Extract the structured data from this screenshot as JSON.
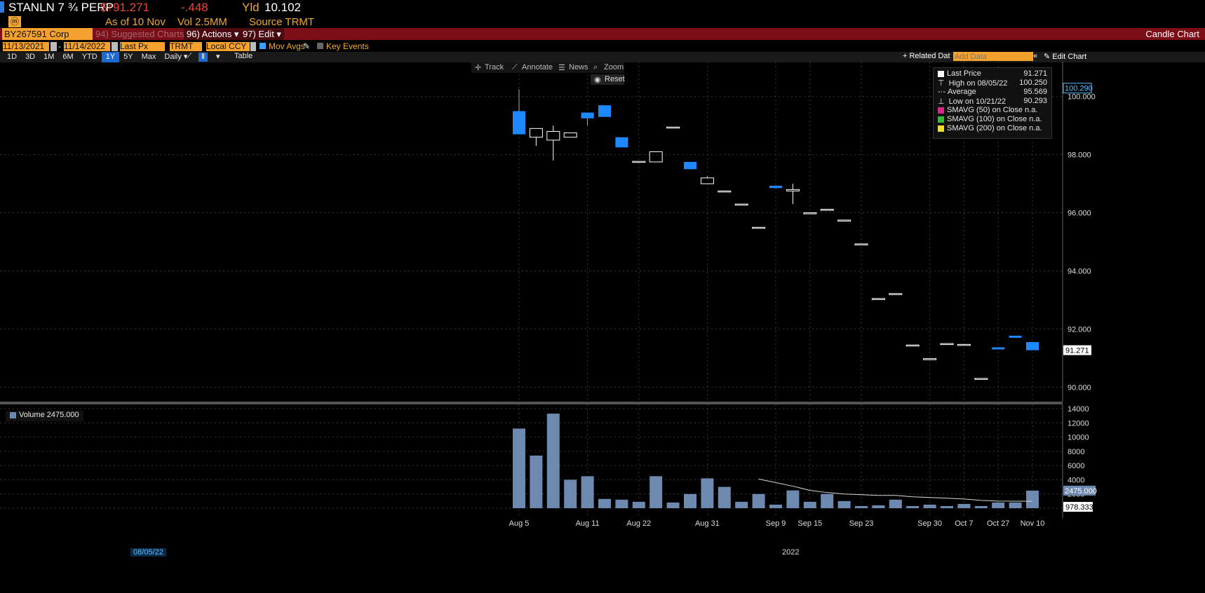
{
  "header": {
    "ticker": "STANLN 7 ¾ PERP",
    "price": "$↑91.271",
    "change": "-.448",
    "yld_label": "Yld",
    "yld_value": "10.102",
    "asof": "As of 10 Nov",
    "vol": "Vol 2.5MM",
    "source": "Source TRMT",
    "security": "BY267591 Corp",
    "suggested": "94) Suggested Charts",
    "actions": "96) Actions ▾",
    "edit": "97) Edit ▾",
    "chart_type": "Candle Chart"
  },
  "options": {
    "start_date": "11/13/2021",
    "end_date": "11/14/2022",
    "field": "Last Px",
    "source": "TRMT",
    "currency": "Local CCY",
    "mov_avgs": "Mov Avgs",
    "key_events": "Key Events",
    "related_data": "+ Related Dat",
    "add_data_placeholder": "Add Data",
    "edit_chart": "✎ Edit Chart"
  },
  "ranges": [
    "1D",
    "3D",
    "1M",
    "6M",
    "YTD",
    "1Y",
    "5Y",
    "Max"
  ],
  "range_selected": "1Y",
  "period": "Daily ▾",
  "table_label": "Table",
  "tools": {
    "track": "Track",
    "annotate": "Annotate",
    "news": "News",
    "zoom": "Zoom",
    "reset": "Reset"
  },
  "legend": {
    "last_price_label": "Last Price",
    "last_price_value": "91.271",
    "high_label": "High on 08/05/22",
    "high_value": "100.250",
    "avg_label": "Average",
    "avg_value": "95.569",
    "low_label": "Low on 10/21/22",
    "low_value": "90.293",
    "sma50": "SMAVG (50)  on Close  n.a.",
    "sma100": "SMAVG (100)  on Close n.a.",
    "sma200": "SMAVG (200)  on Close n.a.",
    "colors": {
      "sma50": "#e0208c",
      "sma100": "#2fc02f",
      "sma200": "#f0e020"
    }
  },
  "volume_legend": "Volume 2475.000",
  "selected_date": "08/05/22",
  "year_label": "2022",
  "chart_data": {
    "type": "bar",
    "candles": [
      {
        "o": 98.7,
        "h": 100.25,
        "l": 98.7,
        "c": 99.5,
        "up": false
      },
      {
        "o": 98.9,
        "h": 98.9,
        "l": 98.3,
        "c": 98.6,
        "up": true
      },
      {
        "o": 98.5,
        "h": 99.0,
        "l": 97.8,
        "c": 98.8,
        "up": true
      },
      {
        "o": 98.6,
        "h": 98.75,
        "l": 98.6,
        "c": 98.75,
        "up": true
      },
      {
        "o": 99.45,
        "h": 99.45,
        "l": 99.0,
        "c": 99.25,
        "up": false
      },
      {
        "o": 99.7,
        "h": 99.7,
        "l": 99.3,
        "c": 99.3,
        "up": false
      },
      {
        "o": 98.6,
        "h": 98.6,
        "l": 98.25,
        "c": 98.25,
        "up": false
      },
      {
        "o": 97.77,
        "h": 97.77,
        "l": 97.77,
        "c": 97.77,
        "up": true
      },
      {
        "o": 97.75,
        "h": 98.1,
        "l": 97.75,
        "c": 98.1,
        "up": true
      },
      {
        "o": 98.95,
        "h": 98.95,
        "l": 98.95,
        "c": 98.95,
        "up": true
      },
      {
        "o": 97.75,
        "h": 97.75,
        "l": 97.5,
        "c": 97.5,
        "up": false
      },
      {
        "o": 97.0,
        "h": 97.25,
        "l": 97.0,
        "c": 97.2,
        "up": true
      },
      {
        "o": 96.75,
        "h": 96.75,
        "l": 96.75,
        "c": 96.75,
        "up": true
      },
      {
        "o": 96.3,
        "h": 96.3,
        "l": 96.3,
        "c": 96.3,
        "up": true
      },
      {
        "o": 95.5,
        "h": 95.5,
        "l": 95.5,
        "c": 95.5,
        "up": true
      },
      {
        "o": 96.93,
        "h": 96.93,
        "l": 96.85,
        "c": 96.85,
        "up": false
      },
      {
        "o": 96.75,
        "h": 97.0,
        "l": 96.3,
        "c": 96.8,
        "up": true
      },
      {
        "o": 96.0,
        "h": 96.0,
        "l": 96.0,
        "c": 96.0,
        "up": true
      },
      {
        "o": 96.12,
        "h": 96.12,
        "l": 96.12,
        "c": 96.12,
        "up": true
      },
      {
        "o": 95.75,
        "h": 95.75,
        "l": 95.75,
        "c": 95.75,
        "up": true
      },
      {
        "o": 94.93,
        "h": 94.93,
        "l": 94.93,
        "c": 94.93,
        "up": true
      },
      {
        "o": 93.05,
        "h": 93.05,
        "l": 93.05,
        "c": 93.05,
        "up": true
      },
      {
        "o": 93.22,
        "h": 93.22,
        "l": 93.22,
        "c": 93.22,
        "up": true
      },
      {
        "o": 91.45,
        "h": 91.45,
        "l": 91.45,
        "c": 91.45,
        "up": true
      },
      {
        "o": 90.98,
        "h": 90.98,
        "l": 90.98,
        "c": 90.98,
        "up": true
      },
      {
        "o": 91.5,
        "h": 91.5,
        "l": 91.5,
        "c": 91.5,
        "up": true
      },
      {
        "o": 91.47,
        "h": 91.47,
        "l": 91.47,
        "c": 91.47,
        "up": true
      },
      {
        "o": 90.3,
        "h": 90.3,
        "l": 90.3,
        "c": 90.3,
        "up": true
      },
      {
        "o": 91.37,
        "h": 91.37,
        "l": 91.33,
        "c": 91.33,
        "up": false
      },
      {
        "o": 91.77,
        "h": 91.77,
        "l": 91.72,
        "c": 91.72,
        "up": false
      },
      {
        "o": 91.55,
        "h": 91.55,
        "l": 91.27,
        "c": 91.27,
        "up": false
      }
    ],
    "volume": [
      11200,
      7400,
      13300,
      4000,
      4500,
      1300,
      1200,
      900,
      4500,
      800,
      2000,
      4200,
      3000,
      900,
      2000,
      500,
      2500,
      900,
      2000,
      1000,
      300,
      400,
      1200,
      300,
      500,
      300,
      600,
      300,
      800,
      800,
      2475
    ],
    "volume_ma": [
      null,
      null,
      null,
      null,
      null,
      null,
      null,
      null,
      null,
      null,
      null,
      null,
      null,
      null,
      4100,
      3600,
      3100,
      2500,
      2200,
      2000,
      1900,
      1800,
      1800,
      1600,
      1500,
      1400,
      1300,
      1100,
      1000,
      980,
      978.333
    ],
    "x_ticks": [
      "Aug 5",
      "Aug 11",
      "Aug 22",
      "Aug 31",
      "Sep 9",
      "Sep 15",
      "Sep 23",
      "Sep 30",
      "Oct 7",
      "Oct 27",
      "Nov 10"
    ],
    "y_ticks": [
      "90.000",
      "92.000",
      "94.000",
      "96.000",
      "98.000",
      "100.000"
    ],
    "vol_ticks": [
      "0",
      "2000",
      "4000",
      "6000",
      "8000",
      "10000",
      "12000",
      "14000"
    ],
    "ylim": [
      89.5,
      101.2
    ],
    "vol_ylim": [
      0,
      14000
    ],
    "last_price_label": "91.271",
    "high_marker_label": "100.290",
    "vol_last_label": "2475.000",
    "vol_ma_label": "978.333",
    "colors": {
      "down": "#1e88ff",
      "up_stroke": "#ffffff",
      "volume": "#6e89b0",
      "ma": "#d8d8d8",
      "grid": "#3a3a3a"
    }
  }
}
